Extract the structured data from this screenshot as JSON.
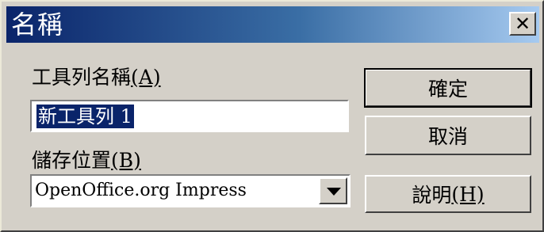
{
  "dialog": {
    "title": "名稱",
    "close_glyph": "✕",
    "toolbar_name_label": "工具列名稱",
    "toolbar_name_accel": "(A)",
    "toolbar_name_value": "新工具列 1",
    "save_location_label": "儲存位置",
    "save_location_accel": "(B)",
    "save_location_value": "OpenOffice.org Impress",
    "ok_label": "確定",
    "cancel_label": "取消",
    "help_label": "說明",
    "help_accel": "(H)"
  },
  "icons": {
    "close": "close-icon",
    "dropdown": "chevron-down-icon"
  },
  "colors": {
    "title_gradient_start": "#0a246a",
    "title_gradient_end": "#a6caf0",
    "dialog_face": "#d4d0c8",
    "selection": "#0a246a"
  }
}
